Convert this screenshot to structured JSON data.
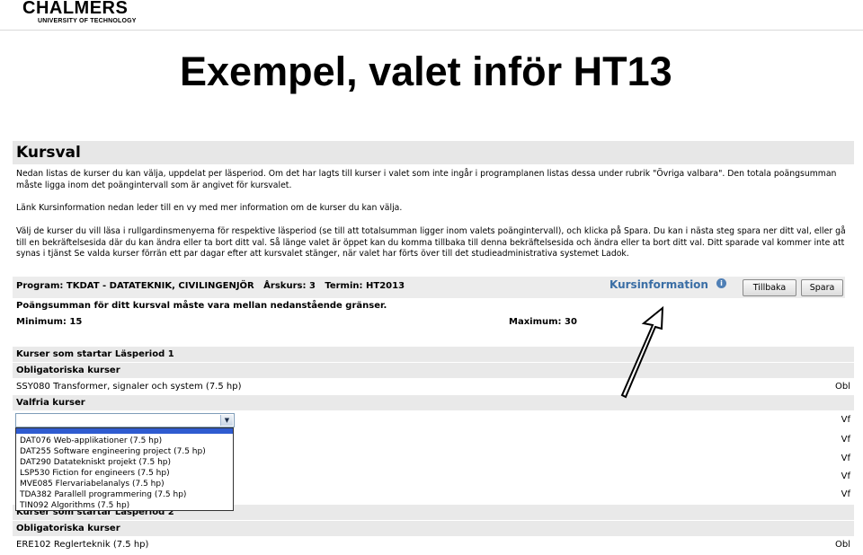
{
  "logo": {
    "name": "CHALMERS",
    "subtitle": "UNIVERSITY OF TECHNOLOGY"
  },
  "slide_title": "Exempel, valet inför HT13",
  "page": {
    "heading": "Kursval",
    "paragraph_1": "Nedan listas de kurser du kan välja, uppdelat per läsperiod. Om det har lagts till kurser i valet som inte ingår i programplanen listas dessa under rubrik \"Övriga valbara\". Den totala poängsumman måste ligga inom det poängintervall som är angivet för kursvalet.",
    "paragraph_2": "Länk Kursinformation nedan leder till en vy med mer information om de kurser du kan välja.",
    "paragraph_3": "Välj de kurser du vill läsa i rullgardinsmenyerna för respektive läsperiod (se till att totalsumman ligger inom valets poängintervall), och klicka på Spara. Du kan i nästa steg spara ner ditt val, eller gå till en bekräftelsesida där du kan ändra eller ta bort ditt val. Så länge valet är öppet kan du komma tillbaka till denna bekräftelsesida och ändra eller ta bort ditt val. Ditt sparade val kommer inte att synas i tjänst Se valda kurser förrän ett par dagar efter att kursvalet stänger, när valet har förts över till det studieadministrativa systemet Ladok.",
    "program_line": "Program: TKDAT - DATATEKNIK, CIVILINGENJÖR   Årskurs: 3   Termin: HT2013",
    "kursinfo_link": "Kursinformation",
    "info_icon_glyph": "i",
    "back_button": "Tillbaka",
    "save_button": "Spara",
    "points_text": "Poängsumman för ditt kursval måste vara mellan nedanstående gränser.",
    "minimum": "Minimum: 15",
    "maximum": "Maximum: 30",
    "period1_header": "Kurser som startar Läsperiod 1",
    "mandatory_header": "Obligatoriska kurser",
    "mandatory_course": "SSY080 Transformer, signaler och system (7.5 hp)",
    "mandatory_code": "Obl",
    "elective_header": "Valfria kurser",
    "select_arrow": "▼",
    "vf_labels": [
      "Vf",
      "Vf",
      "Vf",
      "Vf",
      "Vf"
    ],
    "dropdown_options": [
      "DAT076 Web-applikationer (7.5 hp)",
      "DAT255 Software engineering project (7.5 hp)",
      "DAT290 Datatekniskt projekt (7.5 hp)",
      "LSP530 Fiction for engineers (7.5 hp)",
      "MVE085 Flervariabelanalys (7.5 hp)",
      "TDA382 Parallell programmering (7.5 hp)",
      "TIN092 Algorithms (7.5 hp)"
    ],
    "period2_header": "Kurser som startar Läsperiod 2",
    "mandatory_header_2": "Obligatoriska kurser",
    "mandatory_course_2": "ERE102 Reglerteknik (7.5 hp)",
    "mandatory_code_2": "Obl"
  },
  "colors": {
    "link_blue": "#3a6ea5",
    "selection_blue": "#2f5bd0",
    "row_gray": "#e9e9e9"
  }
}
